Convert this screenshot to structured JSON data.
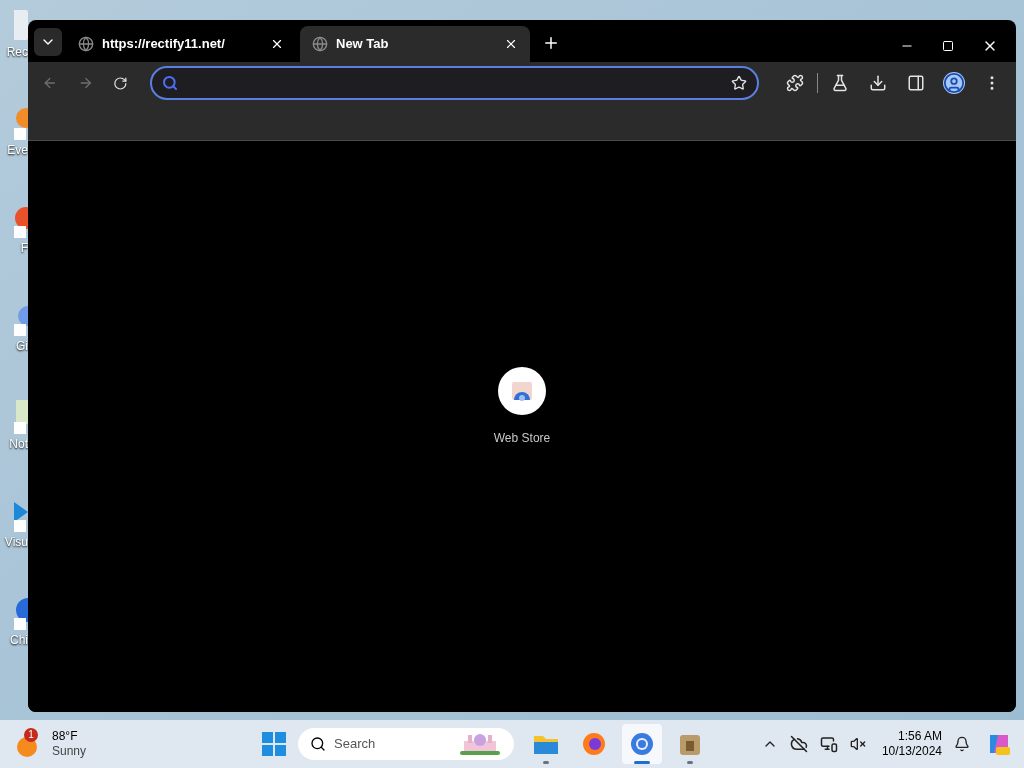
{
  "desktop": {
    "icons": [
      {
        "kind": "bin",
        "label": "Rec"
      },
      {
        "kind": "calendar",
        "label": "Eve"
      },
      {
        "kind": "flame",
        "label": "F"
      },
      {
        "kind": "globe",
        "label": "Gi"
      },
      {
        "kind": "notepad",
        "label": "Not"
      },
      {
        "kind": "code",
        "label": "Visu"
      },
      {
        "kind": "browser",
        "label": "Chi"
      }
    ]
  },
  "browser": {
    "tabs": [
      {
        "title": "https://rectify11.net/",
        "selected": false
      },
      {
        "title": "New Tab",
        "selected": true
      }
    ],
    "shortcuts": [
      {
        "label": "Web Store"
      }
    ]
  },
  "taskbar": {
    "weather": {
      "badge": "1",
      "temperature": "88°F",
      "condition": "Sunny"
    },
    "search": {
      "placeholder": "Search"
    },
    "apps": [
      {
        "kind": "folder",
        "running": true,
        "selected": false
      },
      {
        "kind": "firefox",
        "running": false,
        "selected": false
      },
      {
        "kind": "chrome",
        "running": true,
        "selected": true
      },
      {
        "kind": "package",
        "running": true,
        "selected": false
      }
    ],
    "clock": {
      "time": "1:56 AM",
      "date": "10/13/2024"
    }
  }
}
